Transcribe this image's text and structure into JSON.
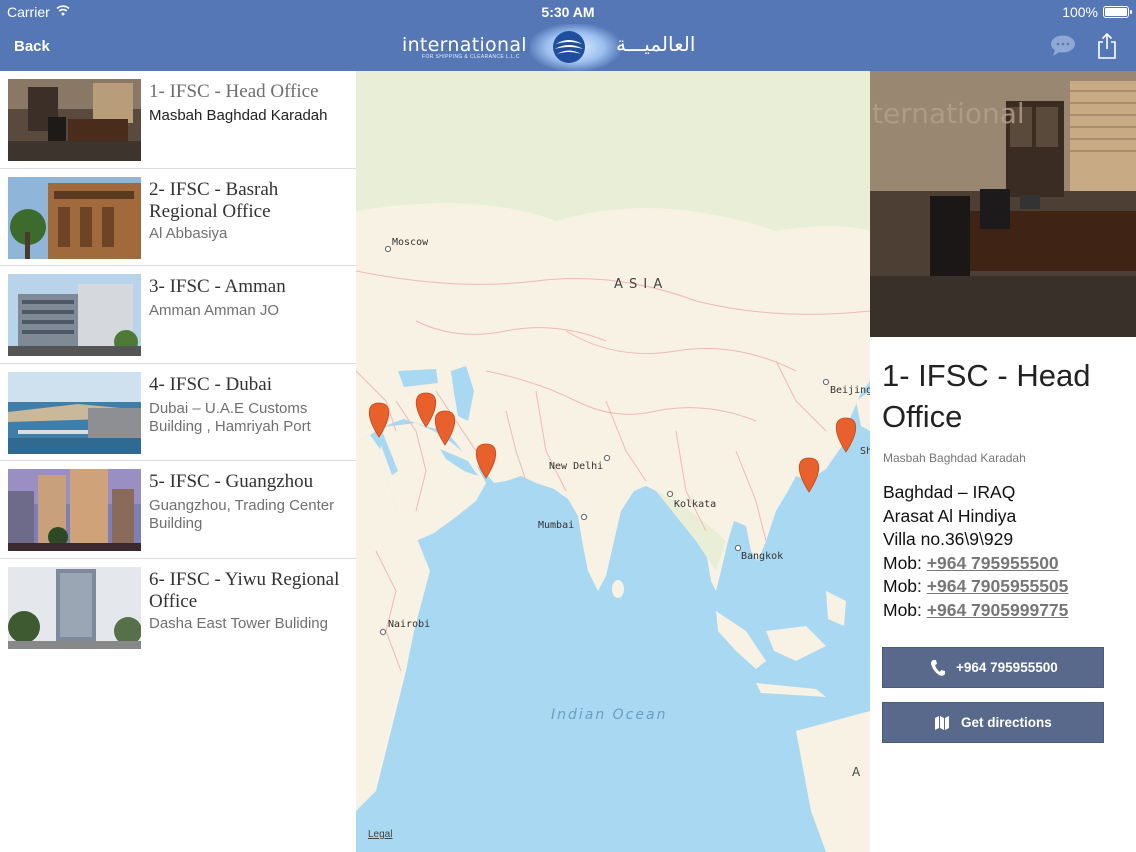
{
  "status": {
    "carrier": "Carrier",
    "time": "5:30 AM",
    "battery": "100%"
  },
  "nav": {
    "back": "Back",
    "logo_en": "international",
    "logo_sub": "FOR SHIPPING & CLEARANCE L.L.C",
    "logo_ar": "العالميـــة"
  },
  "offices": [
    {
      "title": "1- IFSC - Head Office",
      "subtitle": "Masbah Baghdad Karadah"
    },
    {
      "title": "2- IFSC - Basrah Regional Office",
      "subtitle": "Al Abbasiya"
    },
    {
      "title": "3- IFSC - Amman",
      "subtitle": "Amman Amman JO"
    },
    {
      "title": "4- IFSC - Dubai",
      "subtitle": "Dubai – U.A.E Customs Building , Hamriyah Port"
    },
    {
      "title": "5- IFSC - Guangzhou",
      "subtitle": "Guangzhou, Trading Center Building"
    },
    {
      "title": "6- IFSC - Yiwu Regional Office",
      "subtitle": "Dasha East Tower Buliding"
    }
  ],
  "map": {
    "labels": {
      "moscow": "Moscow",
      "asia": "A S I A",
      "beijing": "Beijing",
      "sh": "Sh",
      "new_delhi": "New Delhi",
      "kolkata": "Kolkata",
      "mumbai": "Mumbai",
      "bangkok": "Bangkok",
      "nairobi": "Nairobi",
      "indian_ocean": "Indian Ocean",
      "a": "A"
    },
    "legal": "Legal",
    "pin_color": "#e8602c"
  },
  "detail": {
    "photo_text": "ternational",
    "title": "1- IFSC - Head Office",
    "address": "Masbah Baghdad Karadah",
    "line1": "Baghdad – IRAQ",
    "line2": "Arasat Al Hindiya",
    "line3": "Villa no.36\\9\\929",
    "mob_label": "Mob:",
    "mob1": "+964 795955500",
    "mob2": "+964 7905955505",
    "mob3": "+964 7905999775",
    "call_button": "+964 795955500",
    "directions_button": "Get directions"
  },
  "colors": {
    "brand": "#5577b6",
    "button": "#58698c"
  }
}
